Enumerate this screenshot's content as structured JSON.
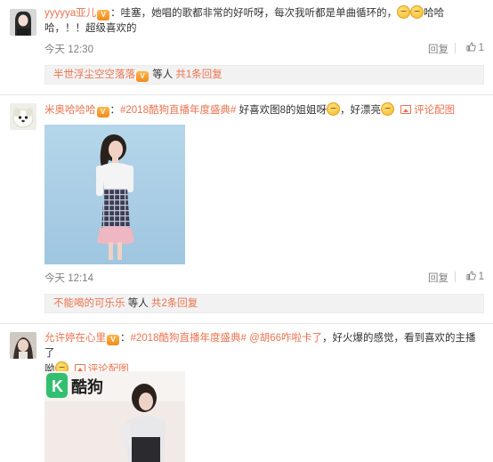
{
  "comments": [
    {
      "user": "yyyyya亚儿",
      "text1": "：哇塞，她唱的歌都非常的好听呀，每次我听都是单曲循环的，",
      "text2": "哈哈",
      "text3": "哈，！！超级喜欢的",
      "time": "今天 12:30",
      "reply": "回复",
      "likes": "1",
      "sub_user": "半世浮尘空空落落",
      "sub_mid": "等人",
      "sub_count": "共1条回复"
    },
    {
      "user": "米奥哈哈哈",
      "topic": "#2018酷狗直播年度盛典#",
      "text1": "好喜欢图8的姐姐呀",
      "text2": "，好漂亮",
      "pic_link": "评论配图",
      "time": "今天 12:14",
      "reply": "回复",
      "likes": "1",
      "sub_user": "不能喝的可乐乐",
      "sub_mid": "等人",
      "sub_count": "共2条回复"
    },
    {
      "user": "允许婷在心里",
      "topic": "#2018酷狗直播年度盛典#",
      "mention": "@胡66咋啦卡了",
      "text1": "，好火爆的感觉，看到喜欢的主播了",
      "text2": "呦",
      "pic_link": "评论配图"
    }
  ],
  "colors": {
    "accent": "#eb7350",
    "sub_bg": "#f2f2f2",
    "meta": "#808080"
  },
  "icons": [
    "vip-badge-icon",
    "emoji-icon",
    "picture-icon",
    "thumb-up-icon"
  ]
}
